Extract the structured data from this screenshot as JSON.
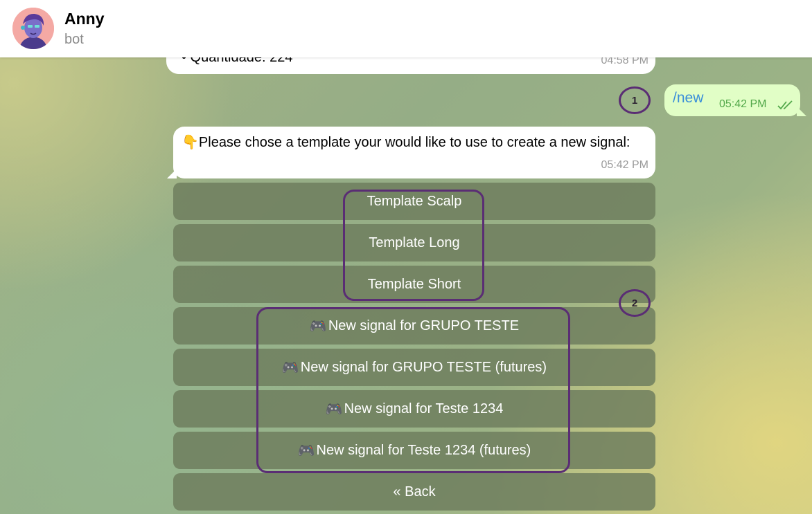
{
  "header": {
    "chat_name": "Anny",
    "chat_status": "bot",
    "avatar_icon": "bot-avatar-icon"
  },
  "messages": {
    "previous": {
      "text": "• Quantidade: 224",
      "time": "04:58 PM"
    },
    "outgoing": {
      "text": "/new",
      "time": "05:42 PM",
      "status_icon": "double-check-icon"
    },
    "prompt": {
      "emoji": "👇",
      "text": "Please chose a template your would like to use to create a new signal:",
      "time": "05:42 PM"
    }
  },
  "keyboard": {
    "buttons": [
      {
        "emoji": "",
        "label": "Template Scalp"
      },
      {
        "emoji": "",
        "label": "Template Long"
      },
      {
        "emoji": "",
        "label": "Template Short"
      },
      {
        "emoji": "🎮",
        "label": "New signal for GRUPO TESTE"
      },
      {
        "emoji": "🎮",
        "label": "New signal for GRUPO TESTE (futures)"
      },
      {
        "emoji": "🎮",
        "label": "New signal for Teste 1234"
      },
      {
        "emoji": "🎮",
        "label": "New signal for Teste 1234 (futures)"
      },
      {
        "emoji": "",
        "label": "« Back"
      }
    ]
  },
  "annotations": {
    "marker_1": "1",
    "marker_2": "2",
    "color": "#5a2d74"
  },
  "colors": {
    "outgoing_bubble": "#e1fec6",
    "link": "#3a8fd9",
    "button_bg": "#6e7e5e"
  }
}
